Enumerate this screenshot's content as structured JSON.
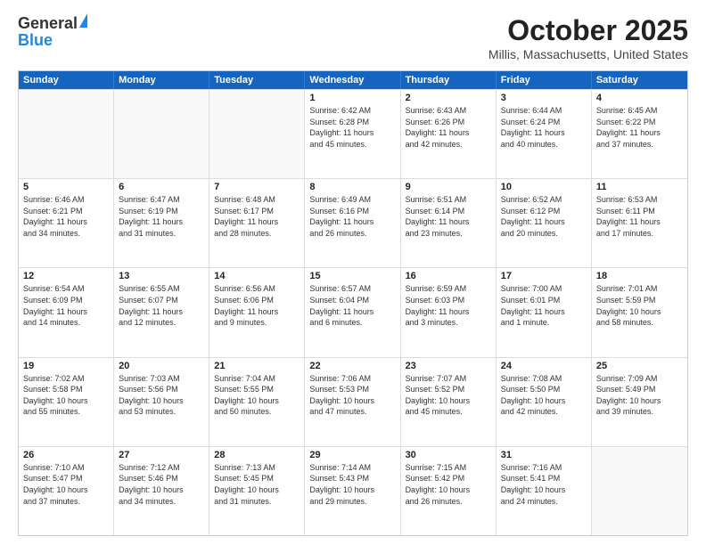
{
  "header": {
    "logo_general": "General",
    "logo_blue": "Blue",
    "month_title": "October 2025",
    "location": "Millis, Massachusetts, United States"
  },
  "calendar": {
    "days_of_week": [
      "Sunday",
      "Monday",
      "Tuesday",
      "Wednesday",
      "Thursday",
      "Friday",
      "Saturday"
    ],
    "rows": [
      [
        {
          "day": "",
          "empty": true,
          "text": ""
        },
        {
          "day": "",
          "empty": true,
          "text": ""
        },
        {
          "day": "",
          "empty": true,
          "text": ""
        },
        {
          "day": "1",
          "empty": false,
          "text": "Sunrise: 6:42 AM\nSunset: 6:28 PM\nDaylight: 11 hours\nand 45 minutes."
        },
        {
          "day": "2",
          "empty": false,
          "text": "Sunrise: 6:43 AM\nSunset: 6:26 PM\nDaylight: 11 hours\nand 42 minutes."
        },
        {
          "day": "3",
          "empty": false,
          "text": "Sunrise: 6:44 AM\nSunset: 6:24 PM\nDaylight: 11 hours\nand 40 minutes."
        },
        {
          "day": "4",
          "empty": false,
          "text": "Sunrise: 6:45 AM\nSunset: 6:22 PM\nDaylight: 11 hours\nand 37 minutes."
        }
      ],
      [
        {
          "day": "5",
          "empty": false,
          "text": "Sunrise: 6:46 AM\nSunset: 6:21 PM\nDaylight: 11 hours\nand 34 minutes."
        },
        {
          "day": "6",
          "empty": false,
          "text": "Sunrise: 6:47 AM\nSunset: 6:19 PM\nDaylight: 11 hours\nand 31 minutes."
        },
        {
          "day": "7",
          "empty": false,
          "text": "Sunrise: 6:48 AM\nSunset: 6:17 PM\nDaylight: 11 hours\nand 28 minutes."
        },
        {
          "day": "8",
          "empty": false,
          "text": "Sunrise: 6:49 AM\nSunset: 6:16 PM\nDaylight: 11 hours\nand 26 minutes."
        },
        {
          "day": "9",
          "empty": false,
          "text": "Sunrise: 6:51 AM\nSunset: 6:14 PM\nDaylight: 11 hours\nand 23 minutes."
        },
        {
          "day": "10",
          "empty": false,
          "text": "Sunrise: 6:52 AM\nSunset: 6:12 PM\nDaylight: 11 hours\nand 20 minutes."
        },
        {
          "day": "11",
          "empty": false,
          "text": "Sunrise: 6:53 AM\nSunset: 6:11 PM\nDaylight: 11 hours\nand 17 minutes."
        }
      ],
      [
        {
          "day": "12",
          "empty": false,
          "text": "Sunrise: 6:54 AM\nSunset: 6:09 PM\nDaylight: 11 hours\nand 14 minutes."
        },
        {
          "day": "13",
          "empty": false,
          "text": "Sunrise: 6:55 AM\nSunset: 6:07 PM\nDaylight: 11 hours\nand 12 minutes."
        },
        {
          "day": "14",
          "empty": false,
          "text": "Sunrise: 6:56 AM\nSunset: 6:06 PM\nDaylight: 11 hours\nand 9 minutes."
        },
        {
          "day": "15",
          "empty": false,
          "text": "Sunrise: 6:57 AM\nSunset: 6:04 PM\nDaylight: 11 hours\nand 6 minutes."
        },
        {
          "day": "16",
          "empty": false,
          "text": "Sunrise: 6:59 AM\nSunset: 6:03 PM\nDaylight: 11 hours\nand 3 minutes."
        },
        {
          "day": "17",
          "empty": false,
          "text": "Sunrise: 7:00 AM\nSunset: 6:01 PM\nDaylight: 11 hours\nand 1 minute."
        },
        {
          "day": "18",
          "empty": false,
          "text": "Sunrise: 7:01 AM\nSunset: 5:59 PM\nDaylight: 10 hours\nand 58 minutes."
        }
      ],
      [
        {
          "day": "19",
          "empty": false,
          "text": "Sunrise: 7:02 AM\nSunset: 5:58 PM\nDaylight: 10 hours\nand 55 minutes."
        },
        {
          "day": "20",
          "empty": false,
          "text": "Sunrise: 7:03 AM\nSunset: 5:56 PM\nDaylight: 10 hours\nand 53 minutes."
        },
        {
          "day": "21",
          "empty": false,
          "text": "Sunrise: 7:04 AM\nSunset: 5:55 PM\nDaylight: 10 hours\nand 50 minutes."
        },
        {
          "day": "22",
          "empty": false,
          "text": "Sunrise: 7:06 AM\nSunset: 5:53 PM\nDaylight: 10 hours\nand 47 minutes."
        },
        {
          "day": "23",
          "empty": false,
          "text": "Sunrise: 7:07 AM\nSunset: 5:52 PM\nDaylight: 10 hours\nand 45 minutes."
        },
        {
          "day": "24",
          "empty": false,
          "text": "Sunrise: 7:08 AM\nSunset: 5:50 PM\nDaylight: 10 hours\nand 42 minutes."
        },
        {
          "day": "25",
          "empty": false,
          "text": "Sunrise: 7:09 AM\nSunset: 5:49 PM\nDaylight: 10 hours\nand 39 minutes."
        }
      ],
      [
        {
          "day": "26",
          "empty": false,
          "text": "Sunrise: 7:10 AM\nSunset: 5:47 PM\nDaylight: 10 hours\nand 37 minutes."
        },
        {
          "day": "27",
          "empty": false,
          "text": "Sunrise: 7:12 AM\nSunset: 5:46 PM\nDaylight: 10 hours\nand 34 minutes."
        },
        {
          "day": "28",
          "empty": false,
          "text": "Sunrise: 7:13 AM\nSunset: 5:45 PM\nDaylight: 10 hours\nand 31 minutes."
        },
        {
          "day": "29",
          "empty": false,
          "text": "Sunrise: 7:14 AM\nSunset: 5:43 PM\nDaylight: 10 hours\nand 29 minutes."
        },
        {
          "day": "30",
          "empty": false,
          "text": "Sunrise: 7:15 AM\nSunset: 5:42 PM\nDaylight: 10 hours\nand 26 minutes."
        },
        {
          "day": "31",
          "empty": false,
          "text": "Sunrise: 7:16 AM\nSunset: 5:41 PM\nDaylight: 10 hours\nand 24 minutes."
        },
        {
          "day": "",
          "empty": true,
          "text": ""
        }
      ]
    ]
  }
}
